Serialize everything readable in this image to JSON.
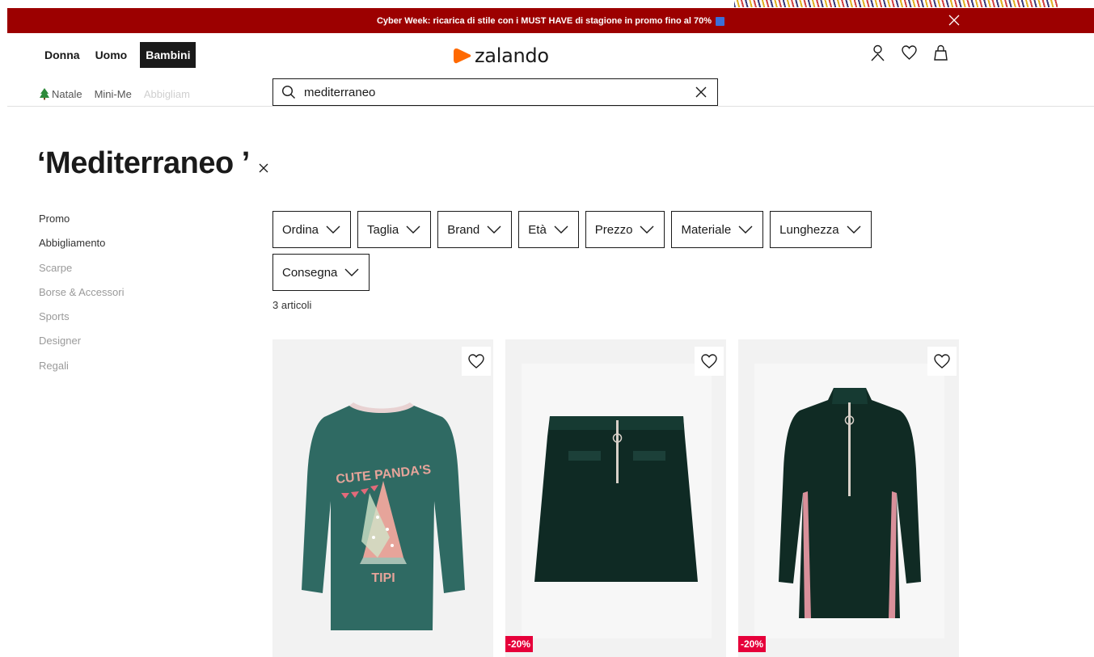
{
  "banner": {
    "text": "Cyber Week: ricarica di stile con i MUST HAVE di stagione in promo fino al 70%"
  },
  "header": {
    "genders": [
      {
        "label": "Donna",
        "active": false
      },
      {
        "label": "Uomo",
        "active": false
      },
      {
        "label": "Bambini",
        "active": true
      }
    ],
    "logo": "zalando",
    "icons": [
      "user-icon",
      "heart-icon",
      "bag-icon"
    ]
  },
  "subnav": {
    "items": [
      "Natale",
      "Mini-Me",
      "Abbigliam"
    ]
  },
  "search": {
    "value": "mediterraneo"
  },
  "page": {
    "title": "‘Mediterraneo ’"
  },
  "categories": [
    {
      "label": "Promo",
      "dim": false
    },
    {
      "label": "Abbigliamento",
      "dim": false
    },
    {
      "label": "Scarpe",
      "dim": true
    },
    {
      "label": "Borse & Accessori",
      "dim": true
    },
    {
      "label": "Sports",
      "dim": true
    },
    {
      "label": "Designer",
      "dim": true
    },
    {
      "label": "Regali",
      "dim": true
    }
  ],
  "filters": {
    "row1": [
      "Ordina",
      "Taglia",
      "Brand",
      "Età",
      "Prezzo",
      "Materiale",
      "Lunghezza"
    ],
    "row2": [
      "Consegna"
    ]
  },
  "results": {
    "count": "3 articoli"
  },
  "products": [
    {
      "badge": "",
      "print_top": "CUTE PANDA'S",
      "print_bottom": "TIPI",
      "color": "#2f6a63"
    },
    {
      "badge": "-20%",
      "color": "#0f2a24"
    },
    {
      "badge": "-20%",
      "color": "#102b24"
    }
  ],
  "colors": {
    "banner": "#9c0000",
    "brand_orange": "#ff6900",
    "discount": "#e6003a"
  }
}
